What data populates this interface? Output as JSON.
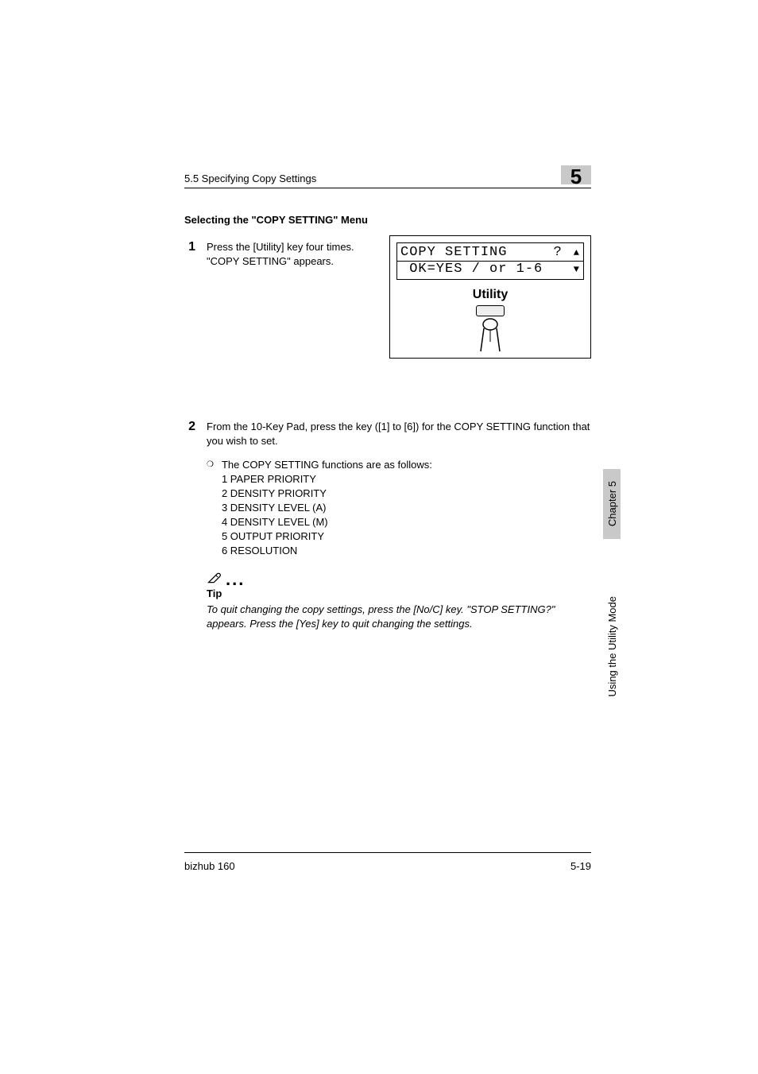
{
  "header": {
    "running_head": "5.5 Specifying Copy Settings",
    "chapter_number": "5"
  },
  "section_title": "Selecting the \"COPY SETTING\" Menu",
  "steps": [
    {
      "num": "1",
      "lines": [
        "Press the [Utility] key four times.",
        "\"COPY SETTING\" appears."
      ]
    },
    {
      "num": "2",
      "lines": [
        "From the 10-Key Pad, press the key ([1] to [6]) for the COPY SETTING function that you wish to set."
      ],
      "sub_intro": "The COPY SETTING functions are as follows:",
      "sub_items": [
        "1 PAPER PRIORITY",
        "2 DENSITY PRIORITY",
        "3 DENSITY LEVEL (A)",
        "4 DENSITY LEVEL (M)",
        "5 OUTPUT PRIORITY",
        "6 RESOLUTION"
      ]
    }
  ],
  "tip": {
    "label": "Tip",
    "text": "To quit changing the copy settings, press the [No/C] key. \"STOP SETTING?\" appears. Press the [Yes] key to quit changing the settings."
  },
  "figure": {
    "lcd_line1_left": "COPY SETTING",
    "lcd_line1_right": "?",
    "lcd_line2": " OK=YES / or 1-6",
    "utility_label": "Utility"
  },
  "side": {
    "chapter_label": "Chapter 5",
    "mode_label": "Using the Utility Mode"
  },
  "footer": {
    "left": "bizhub 160",
    "right": "5-19"
  }
}
